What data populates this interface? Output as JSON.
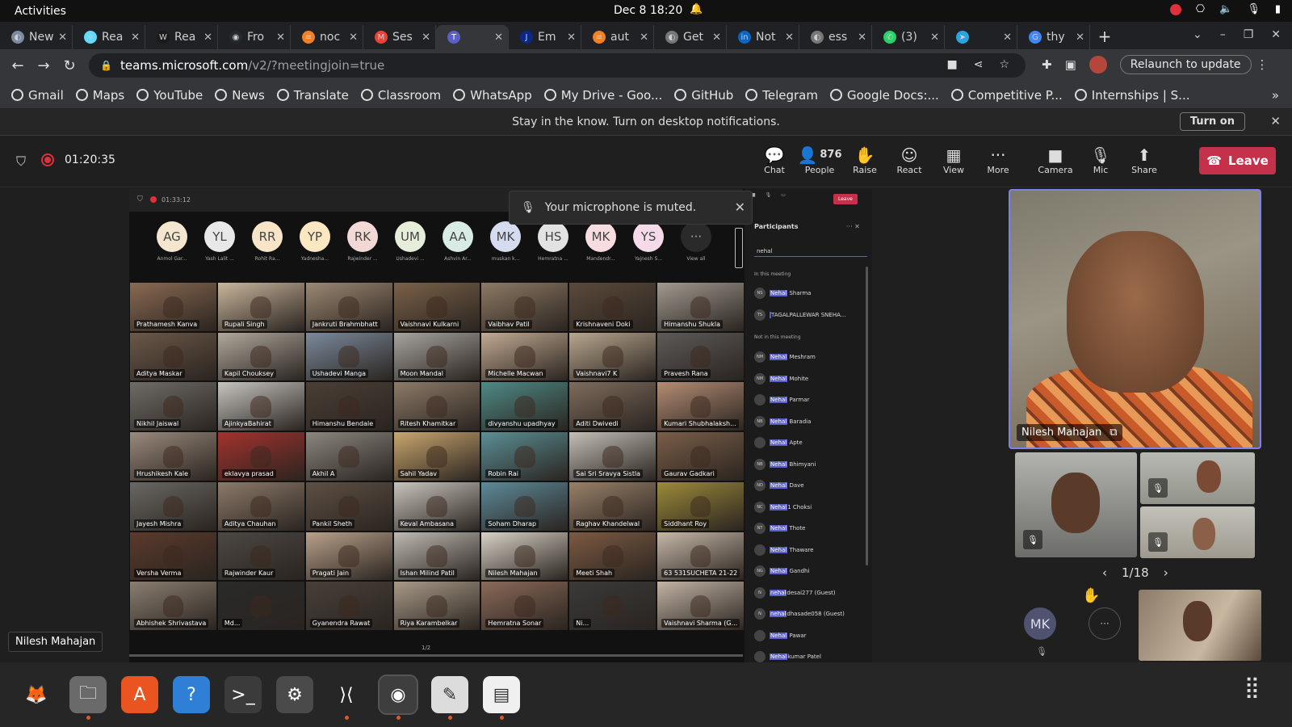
{
  "topbar": {
    "activities": "Activities",
    "clock": "Dec 8  18:20"
  },
  "tabs": [
    {
      "label": "New",
      "color": "#7b8aa0",
      "glyph": "◐"
    },
    {
      "label": "Rea",
      "color": "#61dafb",
      "glyph": "⚛"
    },
    {
      "label": "Rea",
      "color": "#1a1a1a",
      "glyph": "W"
    },
    {
      "label": "Fro",
      "color": "#24292e",
      "glyph": "◉"
    },
    {
      "label": "noc",
      "color": "#f48024",
      "glyph": "≡"
    },
    {
      "label": "Ses",
      "color": "#ea4335",
      "glyph": "M"
    },
    {
      "label": "",
      "color": "#5b5fc7",
      "glyph": "T"
    },
    {
      "label": "Em",
      "color": "#0a2885",
      "glyph": "J"
    },
    {
      "label": "aut",
      "color": "#f48024",
      "glyph": "≡"
    },
    {
      "label": "Get",
      "color": "#777",
      "glyph": "◐"
    },
    {
      "label": "Not",
      "color": "#0a66c2",
      "glyph": "in"
    },
    {
      "label": "ess",
      "color": "#777",
      "glyph": "◐"
    },
    {
      "label": "(3)",
      "color": "#25d366",
      "glyph": "✆"
    },
    {
      "label": "",
      "color": "#2aa3e0",
      "glyph": "➤"
    },
    {
      "label": "thy",
      "color": "#4285f4",
      "glyph": "G"
    }
  ],
  "omnibox": {
    "host": "teams.microsoft.com",
    "path": "/v2/?meetingjoin=true"
  },
  "relaunch": "Relaunch to update",
  "bookmarks": [
    "Gmail",
    "Maps",
    "YouTube",
    "News",
    "Translate",
    "Classroom",
    "WhatsApp",
    "My Drive - Goo...",
    "GitHub",
    "Telegram",
    "Google Docs:...",
    "Competitive P...",
    "Internships | S..."
  ],
  "notif": {
    "text": "Stay in the know. Turn on desktop notifications.",
    "button": "Turn on"
  },
  "meeting": {
    "timer": "01:20:35",
    "controls": [
      {
        "label": "Chat",
        "icon": "💬"
      },
      {
        "label": "People",
        "icon": "👤",
        "count": "876"
      },
      {
        "label": "Raise",
        "icon": "✋"
      },
      {
        "label": "React",
        "icon": "☺"
      },
      {
        "label": "View",
        "icon": "▦"
      },
      {
        "label": "More",
        "icon": "···"
      },
      {
        "label": "Camera",
        "icon": "■"
      },
      {
        "label": "Mic",
        "icon": "🎙"
      },
      {
        "label": "Share",
        "icon": "⬆"
      }
    ],
    "leave": "Leave"
  },
  "shared": {
    "time": "01:33:12",
    "toast": "Your microphone is muted.",
    "avatars": [
      {
        "i": "AG",
        "name": "Anmol Gar...",
        "bg": "#f5e6d0"
      },
      {
        "i": "YL",
        "name": "Yash Lalit ...",
        "bg": "#e8e8e8"
      },
      {
        "i": "RR",
        "name": "Rohit Ra...",
        "bg": "#f8e5c8"
      },
      {
        "i": "YP",
        "name": "Yadnesha...",
        "bg": "#fbe8c2"
      },
      {
        "i": "RK",
        "name": "Rajwinder ...",
        "bg": "#f3d9d6"
      },
      {
        "i": "UM",
        "name": "Ushadevi ...",
        "bg": "#e6eed9"
      },
      {
        "i": "AA",
        "name": "Ashvin Ar...",
        "bg": "#d8ebe4"
      },
      {
        "i": "MK",
        "name": "muskan k...",
        "bg": "#d6dcef"
      },
      {
        "i": "HS",
        "name": "Hemratna ...",
        "bg": "#e2e2e2"
      },
      {
        "i": "MK",
        "name": "Mandendr...",
        "bg": "#f7dde0"
      },
      {
        "i": "YS",
        "name": "Yajnesh S...",
        "bg": "#f5dbe9"
      },
      {
        "i": "···",
        "name": "View all",
        "bg": "#2a2a2a"
      }
    ],
    "tiles": [
      {
        "n": "Prathamesh Kanva",
        "c": "#8a6a52"
      },
      {
        "n": "Rupali Singh",
        "c": "#c9b59c"
      },
      {
        "n": "Jankruti Brahmbhatt",
        "c": "#9c8872"
      },
      {
        "n": "Vaishnavi Kulkarni",
        "c": "#7a6148"
      },
      {
        "n": "Vaibhav Patil",
        "c": "#8e7a64"
      },
      {
        "n": "Krishnaveni Doki",
        "c": "#5a4a3a"
      },
      {
        "n": "Himanshu Shukla",
        "c": "#a09a90"
      },
      {
        "n": "Aditya Maskar",
        "c": "#6b5848"
      },
      {
        "n": "Kapil Chouksey",
        "c": "#b0a89c"
      },
      {
        "n": "Ushadevi Manga",
        "c": "#7b8a9c"
      },
      {
        "n": "Moon Mandal",
        "c": "#a7a49f"
      },
      {
        "n": "Michelle Macwan",
        "c": "#c2aa92"
      },
      {
        "n": "Vaishnavi7 K",
        "c": "#b8a68e"
      },
      {
        "n": "Pravesh Rana",
        "c": "#5d5a58"
      },
      {
        "n": "Nikhil Jaiswal",
        "c": "#6f6c68"
      },
      {
        "n": "AjinkyaBahirat",
        "c": "#c7c5c0"
      },
      {
        "n": "Himanshu Bendale",
        "c": "#4a3f36"
      },
      {
        "n": "Ritesh Khamitkar",
        "c": "#8c7b68"
      },
      {
        "n": "divyanshu upadhyay",
        "c": "#4e8a86"
      },
      {
        "n": "Aditi Dwivedi",
        "c": "#7e6c5c"
      },
      {
        "n": "Kumari Shubhalaksh...",
        "c": "#b48d74"
      },
      {
        "n": "Hrushikesh Kale",
        "c": "#9a8a7c"
      },
      {
        "n": "eklavya prasad",
        "c": "#a4322e"
      },
      {
        "n": "Akhil A",
        "c": "#8b8680"
      },
      {
        "n": "Sahil Yadav",
        "c": "#c9a66e"
      },
      {
        "n": "Robin Rai",
        "c": "#5b8f95"
      },
      {
        "n": "Sai Sri Sravya Sistla",
        "c": "#c3beb6"
      },
      {
        "n": "Gaurav Gadkari",
        "c": "#7a5e48"
      },
      {
        "n": "Jayesh Mishra",
        "c": "#6a6864"
      },
      {
        "n": "Aditya Chauhan",
        "c": "#8c7a6a"
      },
      {
        "n": "Pankil Sheth",
        "c": "#5e5044"
      },
      {
        "n": "Keval Ambasana",
        "c": "#c8c4bc"
      },
      {
        "n": "Soham Dharap",
        "c": "#5d8a99"
      },
      {
        "n": "Raghav Khandelwal",
        "c": "#998068"
      },
      {
        "n": "Siddhant Roy",
        "c": "#9c8a3a"
      },
      {
        "n": "Versha Verma",
        "c": "#5c3a2c"
      },
      {
        "n": "Rajwinder Kaur",
        "c": "#4c4844"
      },
      {
        "n": "Pragati Jain",
        "c": "#b9a18a"
      },
      {
        "n": "Ishan Milind Patil",
        "c": "#bdb9b2"
      },
      {
        "n": "Nilesh Mahajan",
        "c": "#d7d1c6"
      },
      {
        "n": "Meeti Shah",
        "c": "#7c5a42"
      },
      {
        "n": "63 531SUCHETA 21-22",
        "c": "#c6b8a8"
      },
      {
        "n": "Abhishek Shrivastava",
        "c": "#8a7e70"
      },
      {
        "n": "Md...",
        "c": "#2a2a2a"
      },
      {
        "n": "Gyanendra Rawat",
        "c": "#47403a"
      },
      {
        "n": "Riya Karambelkar",
        "c": "#a89a88"
      },
      {
        "n": "Hemratna Sonar",
        "c": "#8a6a58"
      },
      {
        "n": "Ni...",
        "c": "#3a3a3a"
      },
      {
        "n": "Vaishnavi Sharma (G...",
        "c": "#c2b4a6"
      }
    ],
    "page": "1/2",
    "panel": {
      "title": "Participants",
      "search": "nehal",
      "in_meeting": "In this meeting",
      "not_in_meeting": "Not in this meeting",
      "in_list": [
        {
          "i": "NS",
          "hl": "Nehal",
          "rest": " Sharma"
        },
        {
          "i": "TS",
          "hl": "",
          "rest": "TAGALPALLEWAR SNEHA..."
        }
      ],
      "out_list": [
        {
          "i": "NM",
          "hl": "Nehal",
          "rest": " Meshram"
        },
        {
          "i": "NM",
          "hl": "Nehal",
          "rest": " Mohite"
        },
        {
          "i": "",
          "hl": "Nehal",
          "rest": " Parmar"
        },
        {
          "i": "NB",
          "hl": "Nehal",
          "rest": " Baradia"
        },
        {
          "i": "",
          "hl": "Nehal",
          "rest": " Apte"
        },
        {
          "i": "NB",
          "hl": "Nehal",
          "rest": " Bhimyani"
        },
        {
          "i": "ND",
          "hl": "Nehal",
          "rest": " Dave"
        },
        {
          "i": "NC",
          "hl": "Nehal",
          "rest": "1 Choksi"
        },
        {
          "i": "NT",
          "hl": "Nehal",
          "rest": " Thote"
        },
        {
          "i": "",
          "hl": "Nehal",
          "rest": " Thaware"
        },
        {
          "i": "NG",
          "hl": "Nehal",
          "rest": " Gandhi"
        },
        {
          "i": "N",
          "hl": "nehal",
          "rest": "desai277 (Guest)"
        },
        {
          "i": "N",
          "hl": "nehal",
          "rest": "dhasade058 (Guest)"
        },
        {
          "i": "",
          "hl": "Nehal",
          "rest": " Pawar"
        },
        {
          "i": "",
          "hl": "Nehal",
          "rest": "kumar Patel"
        }
      ]
    }
  },
  "mainvideo": {
    "name": "Nilesh Mahajan"
  },
  "side": {
    "pager": "1/18",
    "mk": "MK",
    "tooltip": "Nilesh Mahajan"
  },
  "dock": [
    {
      "name": "firefox-icon",
      "glyph": "🦊",
      "bg": "#262626",
      "running": false
    },
    {
      "name": "files-icon",
      "glyph": "🗀",
      "bg": "#6a6a6a",
      "running": true
    },
    {
      "name": "software-icon",
      "glyph": "A",
      "bg": "#e95420",
      "running": false
    },
    {
      "name": "help-icon",
      "glyph": "?",
      "bg": "#2f7fd6",
      "running": false
    },
    {
      "name": "terminal-icon",
      "glyph": ">_",
      "bg": "#3b3b3b",
      "running": false
    },
    {
      "name": "settings-icon",
      "glyph": "⚙",
      "bg": "#4a4a4a",
      "running": false
    },
    {
      "name": "vscode-icon",
      "glyph": "⟩⟨",
      "bg": "#262626",
      "running": true
    },
    {
      "name": "chrome-icon",
      "glyph": "◉",
      "bg": "#3e3e3e",
      "running": true
    },
    {
      "name": "text-editor-icon",
      "glyph": "✎",
      "bg": "#dcdcdc",
      "running": true
    },
    {
      "name": "screen-reader-icon",
      "glyph": "▤",
      "bg": "#f0f0f0",
      "running": true
    }
  ]
}
